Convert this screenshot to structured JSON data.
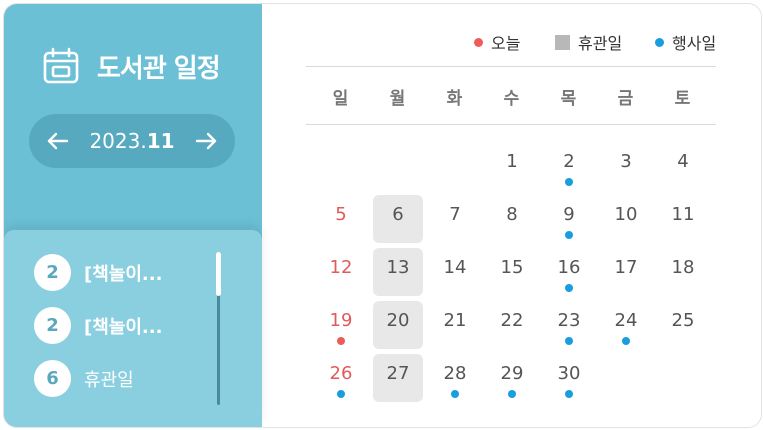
{
  "sidebar": {
    "title": "도서관 일정",
    "month_prefix": "2023.",
    "month_bold": "11",
    "events": [
      {
        "day": "2",
        "text": "[책놀이..."
      },
      {
        "day": "2",
        "text": "[책놀이..."
      },
      {
        "day": "6",
        "text": "휴관일"
      }
    ]
  },
  "legend": {
    "today": "오늘",
    "closed": "휴관일",
    "event": "행사일"
  },
  "weekdays": [
    "일",
    "월",
    "화",
    "수",
    "목",
    "금",
    "토"
  ],
  "colors": {
    "sidebar": "#6cc0d6",
    "today_dot": "#ef5a5a",
    "event_dot": "#1a9de0",
    "holiday_bg": "#e8e8e8",
    "sunday_text": "#e25a5a"
  },
  "calendar": {
    "weeks": [
      [
        {
          "d": ""
        },
        {
          "d": ""
        },
        {
          "d": ""
        },
        {
          "d": "1"
        },
        {
          "d": "2",
          "event": true
        },
        {
          "d": "3"
        },
        {
          "d": "4"
        }
      ],
      [
        {
          "d": "5",
          "sun": true
        },
        {
          "d": "6",
          "holiday": true
        },
        {
          "d": "7"
        },
        {
          "d": "8"
        },
        {
          "d": "9",
          "event": true
        },
        {
          "d": "10"
        },
        {
          "d": "11"
        }
      ],
      [
        {
          "d": "12",
          "sun": true
        },
        {
          "d": "13",
          "holiday": true
        },
        {
          "d": "14"
        },
        {
          "d": "15"
        },
        {
          "d": "16",
          "event": true
        },
        {
          "d": "17"
        },
        {
          "d": "18"
        }
      ],
      [
        {
          "d": "19",
          "sun": true,
          "today": true
        },
        {
          "d": "20",
          "holiday": true
        },
        {
          "d": "21"
        },
        {
          "d": "22"
        },
        {
          "d": "23",
          "event": true
        },
        {
          "d": "24",
          "event": true
        },
        {
          "d": "25"
        }
      ],
      [
        {
          "d": "26",
          "sun": true,
          "event": true
        },
        {
          "d": "27",
          "holiday": true
        },
        {
          "d": "28",
          "event": true
        },
        {
          "d": "29",
          "event": true
        },
        {
          "d": "30",
          "event": true
        },
        {
          "d": ""
        },
        {
          "d": ""
        }
      ]
    ]
  }
}
